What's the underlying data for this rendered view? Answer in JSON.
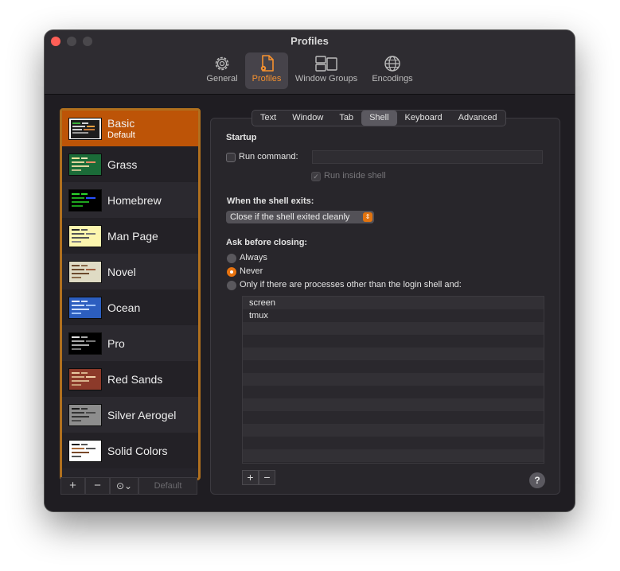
{
  "window": {
    "title": "Profiles"
  },
  "toolbar": [
    {
      "label": "General",
      "icon": "gear-icon",
      "active": false
    },
    {
      "label": "Profiles",
      "icon": "profiles-document-icon",
      "active": true
    },
    {
      "label": "Window Groups",
      "icon": "window-groups-icon",
      "active": false
    },
    {
      "label": "Encodings",
      "icon": "globe-icon",
      "active": false
    }
  ],
  "profiles": [
    {
      "name": "Basic",
      "subtitle": "Default",
      "selected": true
    },
    {
      "name": "Grass"
    },
    {
      "name": "Homebrew"
    },
    {
      "name": "Man Page"
    },
    {
      "name": "Novel"
    },
    {
      "name": "Ocean"
    },
    {
      "name": "Pro"
    },
    {
      "name": "Red Sands"
    },
    {
      "name": "Silver Aerogel"
    },
    {
      "name": "Solid Colors"
    }
  ],
  "profile_bar": {
    "add": "+",
    "remove": "−",
    "more": "⊙⌄",
    "default": "Default"
  },
  "tabs": [
    "Text",
    "Window",
    "Tab",
    "Shell",
    "Keyboard",
    "Advanced"
  ],
  "active_tab": "Shell",
  "shell": {
    "startup_heading": "Startup",
    "run_command_label": "Run command:",
    "run_command_value": "",
    "run_inside_shell_label": "Run inside shell",
    "when_exits_heading": "When the shell exits:",
    "when_exits_value": "Close if the shell exited cleanly",
    "ask_heading": "Ask before closing:",
    "ask_options": [
      "Always",
      "Never",
      "Only if there are processes other than the login shell and:"
    ],
    "ask_selected": "Never",
    "processes": [
      "screen",
      "tmux",
      "",
      "",
      "",
      "",
      "",
      "",
      "",
      "",
      "",
      "",
      ""
    ],
    "process_add": "+",
    "process_remove": "−",
    "help": "?"
  },
  "colors": {
    "accent": "#e8730f",
    "selection": "#bd5407",
    "list_border": "#b0701e"
  }
}
